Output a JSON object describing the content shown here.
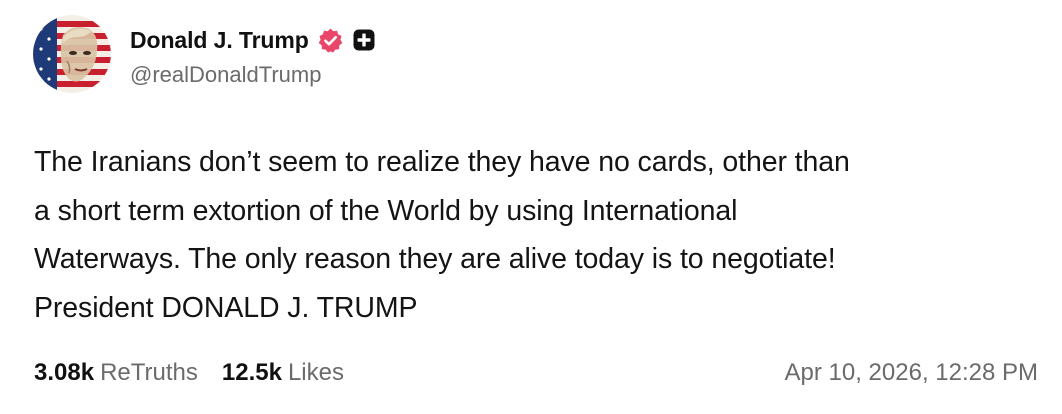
{
  "author": {
    "display_name": "Donald J. Trump",
    "handle": "@realDonaldTrump",
    "verified_icon": "verified-badge-icon",
    "plus_icon": "plus-badge-icon",
    "badge_color": "#e8476a"
  },
  "post": {
    "text": "The Iranians don’t seem to realize they have no cards, other than\na short term extortion of the World by using International\nWaterways. The only reason they are alive today is to negotiate!\nPresident DONALD J. TRUMP"
  },
  "stats": {
    "retruths_count": "3.08k",
    "retruths_label": "ReTruths",
    "likes_count": "12.5k",
    "likes_label": "Likes"
  },
  "timestamp": "Apr 10, 2026, 12:28 PM"
}
